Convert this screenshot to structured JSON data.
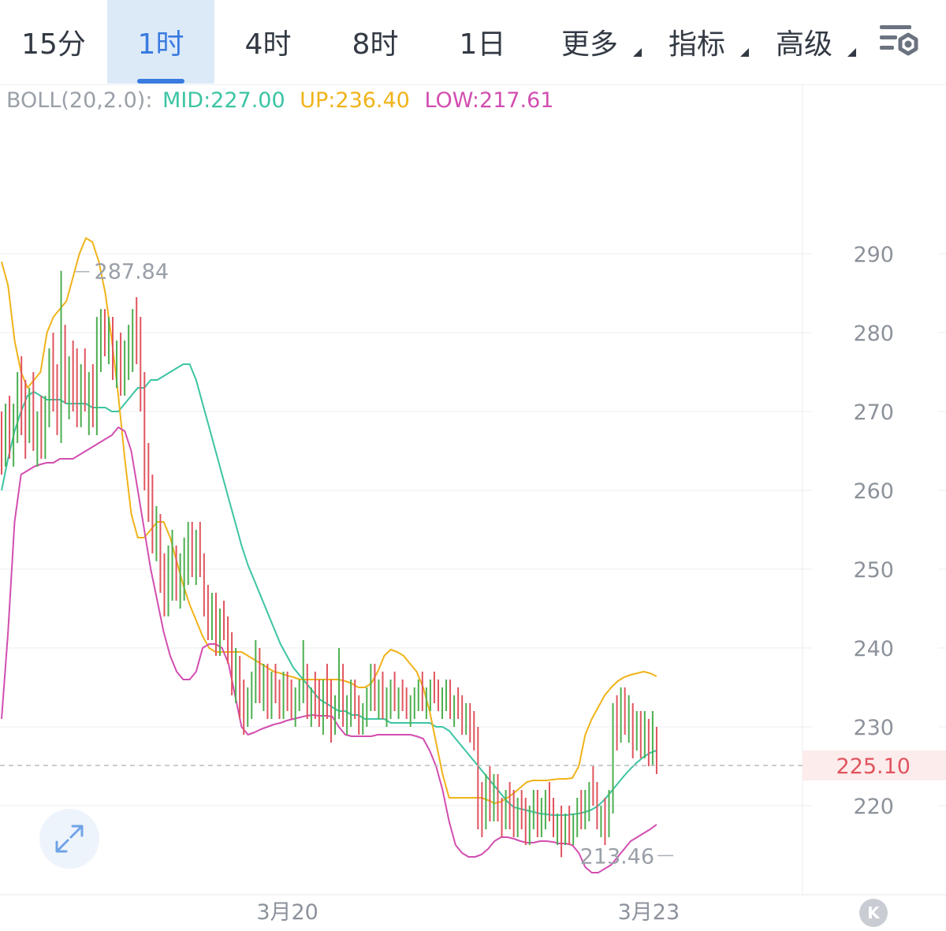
{
  "tabs": [
    {
      "label": "15分",
      "active": false,
      "dropdown": false
    },
    {
      "label": "1时",
      "active": true,
      "dropdown": false
    },
    {
      "label": "4时",
      "active": false,
      "dropdown": false
    },
    {
      "label": "8时",
      "active": false,
      "dropdown": false
    },
    {
      "label": "1日",
      "active": false,
      "dropdown": false
    },
    {
      "label": "更多",
      "active": false,
      "dropdown": true
    },
    {
      "label": "指标",
      "active": false,
      "dropdown": true
    },
    {
      "label": "高级",
      "active": false,
      "dropdown": true
    }
  ],
  "legend": {
    "name": "BOLL(20,2.0):",
    "mid": "MID:227.00",
    "up": "UP:236.40",
    "low": "LOW:217.61"
  },
  "colors": {
    "up_candle": "#4caf50",
    "down_candle": "#e0545e",
    "mid": "#3cc4a3",
    "upper": "#f0b31a",
    "lower": "#d24eb0",
    "price_label": "#e0545e",
    "legend_name": "#9aa0a8",
    "accent": "#3a7be0"
  },
  "icons": {
    "settings": "settings-gear-icon",
    "expand": "expand-arrows-icon",
    "scroll_end": "scroll-to-latest-icon"
  },
  "scroll_end_label": "K",
  "chart_data": {
    "type": "candlestick",
    "interval": "1时",
    "indicator": "BOLL(20,2.0)",
    "y_ticks": [
      290,
      280,
      270,
      260,
      250,
      240,
      230,
      220
    ],
    "x_labels": [
      {
        "label": "3月20",
        "index": 72
      },
      {
        "label": "3月23",
        "index": 163
      }
    ],
    "ylim": [
      209.3,
      298.7
    ],
    "last_price": 225.1,
    "last_price_label": "225.10",
    "max_marker": {
      "index": 15,
      "value": 287.84,
      "label": "287.84"
    },
    "min_marker": {
      "index": 170,
      "value": 213.46,
      "label": "213.46"
    },
    "candles": [
      [
        268,
        270,
        262,
        265
      ],
      [
        265,
        271,
        263,
        268
      ],
      [
        268,
        272,
        264,
        266
      ],
      [
        266,
        271,
        263,
        269
      ],
      [
        269,
        275,
        266,
        272
      ],
      [
        272,
        277,
        267,
        270
      ],
      [
        270,
        274,
        264,
        267
      ],
      [
        267,
        273,
        266,
        271
      ],
      [
        271,
        275,
        265,
        266
      ],
      [
        266,
        270,
        263,
        268
      ],
      [
        268,
        272,
        264,
        265
      ],
      [
        265,
        272,
        264,
        270
      ],
      [
        270,
        278,
        268,
        277
      ],
      [
        277,
        280,
        270,
        272
      ],
      [
        272,
        276,
        267,
        268
      ],
      [
        268,
        287.84,
        266,
        278
      ],
      [
        278,
        281,
        271,
        274
      ],
      [
        274,
        277,
        269,
        275
      ],
      [
        275,
        279,
        270,
        273
      ],
      [
        273,
        278,
        268,
        270
      ],
      [
        270,
        276,
        268,
        274
      ],
      [
        274,
        278,
        270,
        271
      ],
      [
        271,
        275,
        267,
        272
      ],
      [
        272,
        276,
        268,
        269
      ],
      [
        269,
        282,
        267,
        279
      ],
      [
        279,
        283,
        275,
        281
      ],
      [
        281,
        283,
        277,
        278
      ],
      [
        278,
        282,
        276,
        280
      ],
      [
        280,
        282,
        274,
        276
      ],
      [
        276,
        279,
        273,
        277
      ],
      [
        277,
        280,
        272,
        274
      ],
      [
        274,
        279,
        272,
        277
      ],
      [
        277,
        281,
        274,
        279
      ],
      [
        279,
        283,
        275,
        282
      ],
      [
        282,
        284.5,
        276,
        278
      ],
      [
        278,
        282,
        270,
        272
      ],
      [
        272,
        275,
        260,
        262
      ],
      [
        262,
        266,
        256,
        258
      ],
      [
        258,
        262,
        252,
        254
      ],
      [
        254,
        258,
        251,
        256
      ],
      [
        256,
        257,
        247,
        250
      ],
      [
        250,
        252,
        244,
        247
      ],
      [
        247,
        253,
        244,
        250
      ],
      [
        250,
        255,
        246,
        252
      ],
      [
        252,
        253,
        246,
        248
      ],
      [
        248,
        252,
        245,
        249
      ],
      [
        249,
        254,
        246,
        252
      ],
      [
        252,
        256,
        248,
        254
      ],
      [
        254,
        256,
        249,
        251
      ],
      [
        251,
        255,
        248,
        252
      ],
      [
        252,
        256,
        249,
        250
      ],
      [
        250,
        252,
        244,
        246
      ],
      [
        246,
        248,
        241,
        244
      ],
      [
        244,
        247,
        241,
        246
      ],
      [
        246,
        247,
        239,
        242
      ],
      [
        242,
        245,
        239,
        244
      ],
      [
        244,
        246,
        241,
        242
      ],
      [
        242,
        244,
        238,
        240
      ],
      [
        240,
        242,
        234,
        236
      ],
      [
        236,
        240,
        233,
        238
      ],
      [
        238,
        239,
        231,
        234
      ],
      [
        234,
        236,
        229,
        232
      ],
      [
        232,
        235,
        230,
        233
      ],
      [
        233,
        237,
        231,
        235
      ],
      [
        235,
        241,
        233,
        239
      ],
      [
        239,
        240,
        233,
        235
      ],
      [
        235,
        238,
        232,
        236
      ],
      [
        236,
        238,
        231,
        233
      ],
      [
        233,
        237,
        231,
        235
      ],
      [
        235,
        238,
        233,
        234
      ],
      [
        234,
        236,
        231,
        233
      ],
      [
        233,
        237,
        231,
        235
      ],
      [
        235,
        237,
        232,
        234
      ],
      [
        234,
        236,
        231,
        232
      ],
      [
        232,
        235,
        230,
        234
      ],
      [
        234,
        236,
        232,
        235
      ],
      [
        235,
        241,
        233,
        236
      ],
      [
        236,
        238,
        231,
        232
      ],
      [
        232,
        235,
        230,
        234
      ],
      [
        234,
        237,
        231,
        233
      ],
      [
        233,
        236,
        230,
        232
      ],
      [
        232,
        236,
        229,
        234
      ],
      [
        234,
        238,
        231,
        233
      ],
      [
        233,
        236,
        228,
        230
      ],
      [
        230,
        234,
        229,
        233
      ],
      [
        233,
        240,
        231,
        235
      ],
      [
        235,
        238,
        230,
        231
      ],
      [
        231,
        234,
        229,
        232
      ],
      [
        232,
        236,
        230,
        234
      ],
      [
        234,
        236,
        231,
        232
      ],
      [
        232,
        234,
        229,
        230
      ],
      [
        230,
        233,
        229,
        232
      ],
      [
        232,
        235,
        230,
        234
      ],
      [
        234,
        238,
        232,
        236
      ],
      [
        236,
        238,
        232,
        233
      ],
      [
        233,
        236,
        231,
        234
      ],
      [
        234,
        237,
        231,
        232
      ],
      [
        232,
        235,
        230,
        233
      ],
      [
        233,
        236,
        231,
        235
      ],
      [
        235,
        237,
        232,
        233
      ],
      [
        233,
        235,
        231,
        234
      ],
      [
        234,
        236,
        232,
        233
      ],
      [
        233,
        235,
        231,
        232
      ],
      [
        232,
        234,
        230,
        233
      ],
      [
        233,
        235,
        231,
        234
      ],
      [
        234,
        236,
        232,
        235
      ],
      [
        235,
        237,
        232,
        233
      ],
      [
        233,
        235,
        231,
        234
      ],
      [
        234,
        236,
        232,
        235
      ],
      [
        235,
        237,
        233,
        234
      ],
      [
        234,
        236,
        232,
        233
      ],
      [
        233,
        235,
        231,
        234
      ],
      [
        234,
        236,
        232,
        235
      ],
      [
        235,
        236,
        231,
        232
      ],
      [
        232,
        234,
        230,
        233
      ],
      [
        233,
        235,
        231,
        232
      ],
      [
        232,
        234,
        229,
        231
      ],
      [
        231,
        233,
        229,
        232
      ],
      [
        232,
        233,
        228,
        230
      ],
      [
        230,
        232,
        227,
        228
      ],
      [
        228,
        230,
        217,
        220
      ],
      [
        220,
        223,
        216,
        219
      ],
      [
        219,
        224,
        217,
        222
      ],
      [
        222,
        225,
        218,
        221
      ],
      [
        221,
        224,
        218,
        222
      ],
      [
        222,
        224,
        218,
        219
      ],
      [
        219,
        221,
        216,
        218
      ],
      [
        218,
        222,
        217,
        221
      ],
      [
        221,
        223,
        217,
        219
      ],
      [
        219,
        222,
        216,
        218
      ],
      [
        218,
        221,
        216,
        220
      ],
      [
        220,
        222,
        217,
        218
      ],
      [
        218,
        221,
        215,
        217
      ],
      [
        217,
        220,
        215,
        219
      ],
      [
        219,
        222,
        217,
        221
      ],
      [
        221,
        222,
        216,
        218
      ],
      [
        218,
        221,
        216,
        220
      ],
      [
        220,
        222,
        217,
        221
      ],
      [
        221,
        223,
        218,
        219
      ],
      [
        219,
        221,
        216,
        217
      ],
      [
        217,
        219,
        215,
        218
      ],
      [
        218,
        220,
        213.46,
        216
      ],
      [
        216,
        219,
        215,
        218
      ],
      [
        218,
        220,
        215,
        217
      ],
      [
        217,
        219,
        215,
        218
      ],
      [
        218,
        221,
        216,
        220
      ],
      [
        220,
        222,
        217,
        219
      ],
      [
        219,
        222,
        217,
        221
      ],
      [
        221,
        223,
        218,
        222
      ],
      [
        222,
        225,
        220,
        221
      ],
      [
        221,
        223,
        217,
        218
      ],
      [
        218,
        220,
        216,
        219
      ],
      [
        219,
        221,
        215,
        217
      ],
      [
        217,
        222,
        216,
        221
      ],
      [
        221,
        233,
        219,
        231
      ],
      [
        231,
        234,
        227,
        229
      ],
      [
        229,
        235,
        228,
        233
      ],
      [
        233,
        235,
        229,
        230
      ],
      [
        230,
        234,
        228,
        232
      ],
      [
        232,
        233,
        226,
        228
      ],
      [
        228,
        232,
        227,
        230
      ],
      [
        230,
        232,
        226,
        227
      ],
      [
        227,
        232,
        226,
        230
      ],
      [
        230,
        231,
        225,
        226
      ],
      [
        226,
        232,
        225.1,
        229
      ],
      [
        229,
        230,
        224,
        225.1
      ]
    ],
    "series": [
      {
        "name": "MID",
        "values": [
          260.0,
          264.0,
          267.5,
          270.0,
          272.0,
          272.5,
          272.0,
          271.5,
          271.5,
          271.5,
          271.0,
          271.0,
          271.0,
          271.0,
          270.5,
          270.5,
          270.5,
          270.0,
          270.0,
          271.0,
          272.0,
          273.0,
          273.0,
          274.0,
          274.0,
          274.5,
          275.0,
          275.5,
          276.0,
          276.0,
          274.0,
          271.0,
          268.0,
          265.0,
          262.0,
          259.0,
          256.0,
          253.0,
          250.5,
          248.5,
          246.5,
          244.5,
          242.5,
          240.5,
          239.0,
          237.5,
          236.5,
          235.5,
          234.5,
          233.5,
          233.0,
          232.5,
          232.0,
          232.0,
          231.5,
          231.5,
          231.0,
          231.0,
          231.0,
          231.0,
          230.5,
          230.5,
          230.5,
          230.5,
          230.5,
          230.5,
          230.5,
          230.0,
          230.0,
          229.5,
          228.5,
          227.5,
          226.5,
          225.5,
          224.5,
          223.5,
          222.5,
          221.5,
          220.5,
          219.8,
          219.6,
          219.4,
          219.2,
          219.0,
          218.9,
          218.8,
          218.8,
          218.8,
          218.9,
          219.0,
          219.2,
          219.5,
          220.0,
          220.8,
          221.8,
          222.8,
          223.8,
          224.7,
          225.5,
          226.2,
          226.7,
          227.0
        ]
      },
      {
        "name": "UP",
        "values": [
          289.0,
          286.0,
          279.0,
          275.0,
          273.0,
          274.0,
          275.0,
          280.0,
          282.0,
          283.0,
          284.0,
          287.0,
          290.0,
          292.0,
          291.5,
          289.0,
          285.0,
          279.0,
          272.0,
          264.0,
          257.0,
          254.0,
          254.0,
          255.0,
          256.0,
          256.0,
          254.0,
          251.0,
          248.0,
          245.5,
          243.5,
          241.5,
          240.0,
          239.5,
          239.5,
          239.5,
          239.5,
          239.5,
          239.0,
          238.5,
          238.0,
          237.5,
          237.0,
          236.8,
          236.5,
          236.3,
          236.0,
          236.0,
          236.0,
          236.0,
          236.0,
          236.0,
          236.0,
          235.8,
          235.5,
          235.0,
          235.0,
          235.5,
          237.0,
          239.0,
          239.8,
          239.5,
          239.0,
          238.0,
          237.0,
          235.0,
          232.0,
          228.0,
          224.0,
          221.0,
          221.0,
          221.0,
          221.0,
          221.0,
          221.0,
          220.7,
          220.3,
          220.5,
          221.0,
          221.6,
          222.3,
          223.0,
          223.2,
          223.2,
          223.2,
          223.3,
          223.4,
          223.4,
          223.5,
          225.0,
          229.0,
          231.0,
          232.5,
          234.0,
          235.0,
          235.8,
          236.3,
          236.6,
          236.8,
          237.0,
          236.8,
          236.4
        ]
      },
      {
        "name": "LOW",
        "values": [
          231.0,
          242.0,
          256.0,
          262.0,
          262.5,
          263.0,
          263.3,
          263.5,
          263.5,
          264.0,
          264.0,
          264.0,
          264.5,
          265.0,
          265.5,
          266.0,
          266.5,
          267.0,
          268.0,
          267.5,
          265.0,
          260.0,
          255.0,
          250.0,
          246.0,
          242.0,
          239.0,
          237.0,
          236.0,
          236.0,
          237.0,
          240.0,
          240.5,
          240.5,
          240.0,
          238.0,
          234.0,
          230.0,
          229.0,
          229.3,
          229.7,
          230.0,
          230.3,
          230.5,
          230.8,
          231.0,
          231.2,
          231.4,
          231.5,
          231.4,
          231.4,
          231.3,
          230.0,
          229.0,
          228.8,
          228.8,
          228.8,
          228.8,
          229.0,
          229.0,
          229.0,
          229.0,
          229.0,
          229.0,
          228.8,
          228.5,
          227.0,
          225.0,
          222.0,
          218.0,
          215.0,
          214.0,
          213.5,
          213.5,
          213.8,
          214.5,
          215.5,
          216.0,
          216.0,
          215.8,
          215.5,
          215.3,
          215.3,
          215.5,
          215.5,
          215.4,
          215.2,
          215.2,
          215.0,
          214.0,
          212.2,
          211.5,
          211.5,
          212.0,
          212.5,
          213.5,
          214.5,
          215.5,
          216.0,
          216.5,
          217.0,
          217.61
        ]
      }
    ]
  }
}
